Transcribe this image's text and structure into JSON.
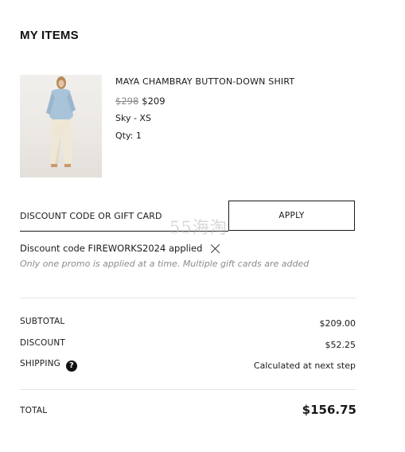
{
  "section_title": "MY ITEMS",
  "product": {
    "name": "MAYA CHAMBRAY BUTTON-DOWN SHIRT",
    "original_price": "$298",
    "sale_price": "$209",
    "variant": "Sky - XS",
    "quantity": "Qty: 1",
    "image_alt": "model wearing light blue chambray shirt and cream wide-leg pants"
  },
  "discount": {
    "label": "DISCOUNT CODE OR GIFT CARD",
    "apply_label": "APPLY",
    "applied_text": "Discount code FIREWORKS2024 applied",
    "note": "Only one promo is applied at a time. Multiple gift cards are added"
  },
  "watermark": "55海淘",
  "summary": {
    "subtotal_label": "SUBTOTAL",
    "subtotal_value": "$209.00",
    "discount_label": "DISCOUNT",
    "discount_value": "$52.25",
    "shipping_label": "SHIPPING",
    "shipping_value": "Calculated at next step",
    "help_glyph": "?",
    "total_label": "TOTAL",
    "total_value": "$156.75"
  },
  "colors": {
    "text": "#1a1a1a",
    "muted": "#8b8b8b",
    "divider": "#e5e5e5",
    "shirt": "#a9c3d9"
  },
  "icons": [
    "close-icon",
    "help-icon"
  ]
}
